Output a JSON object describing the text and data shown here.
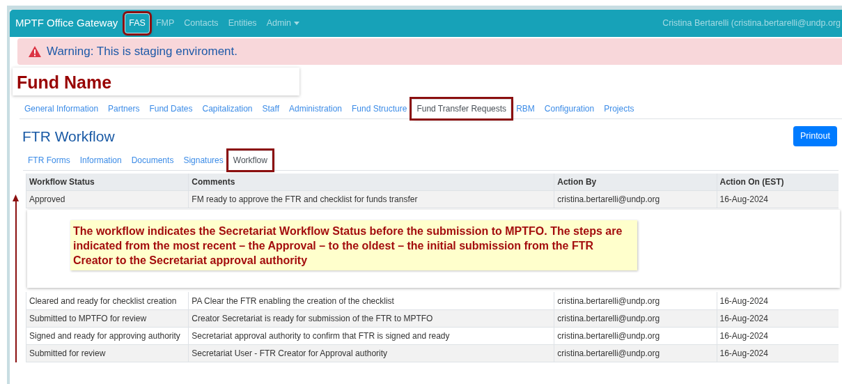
{
  "navbar": {
    "brand": "MPTF Office Gateway",
    "items": [
      {
        "label": "FAS",
        "selected": true,
        "highlighted": true,
        "dropdown": false
      },
      {
        "label": "FMP",
        "selected": false,
        "highlighted": false,
        "dropdown": false
      },
      {
        "label": "Contacts",
        "selected": false,
        "highlighted": false,
        "dropdown": false
      },
      {
        "label": "Entities",
        "selected": false,
        "highlighted": false,
        "dropdown": false
      },
      {
        "label": "Admin",
        "selected": false,
        "highlighted": false,
        "dropdown": true
      }
    ],
    "user": "Cristina Bertarelli (cristina.bertarelli@undp.org"
  },
  "alert": {
    "text": "Warning: This is staging enviroment."
  },
  "fund_title": "Fund Name",
  "fund_tabs": [
    {
      "label": "General Information",
      "selected": false,
      "highlighted": false
    },
    {
      "label": "Partners",
      "selected": false,
      "highlighted": false
    },
    {
      "label": "Fund Dates",
      "selected": false,
      "highlighted": false
    },
    {
      "label": "Capitalization",
      "selected": false,
      "highlighted": false
    },
    {
      "label": "Staff",
      "selected": false,
      "highlighted": false
    },
    {
      "label": "Administration",
      "selected": false,
      "highlighted": false
    },
    {
      "label": "Fund Structure",
      "selected": false,
      "highlighted": false
    },
    {
      "label": "Fund Transfer Requests",
      "selected": true,
      "highlighted": true
    },
    {
      "label": "RBM",
      "selected": false,
      "highlighted": false
    },
    {
      "label": "Configuration",
      "selected": false,
      "highlighted": false
    },
    {
      "label": "Projects",
      "selected": false,
      "highlighted": false
    }
  ],
  "page_title": "FTR Workflow",
  "printout_button": "Printout",
  "sub_tabs": [
    {
      "label": "FTR Forms",
      "selected": false,
      "highlighted": false
    },
    {
      "label": "Information",
      "selected": false,
      "highlighted": false
    },
    {
      "label": "Documents",
      "selected": false,
      "highlighted": false
    },
    {
      "label": "Signatures",
      "selected": false,
      "highlighted": false
    },
    {
      "label": "Workflow",
      "selected": true,
      "highlighted": true
    }
  ],
  "table": {
    "columns": [
      "Workflow Status",
      "Comments",
      "Action By",
      "Action On (EST)"
    ],
    "rows_above": [
      [
        "Approved",
        "FM ready to approve the FTR and checklist for funds transfer",
        "cristina.bertarelli@undp.org",
        "16-Aug-2024"
      ]
    ],
    "rows_below": [
      [
        "Cleared and ready for checklist creation",
        "PA Clear the FTR enabling the creation of the checklist",
        "cristina.bertarelli@undp.org",
        "16-Aug-2024"
      ],
      [
        "Submitted to MPTFO for review",
        "Creator Secretariat is ready for submission of the FTR to MPTFO",
        "cristina.bertarelli@undp.org",
        "16-Aug-2024"
      ],
      [
        "Signed and ready for approving authority",
        "Secretariat approval authority to confirm that FTR is signed and ready",
        "cristina.bertarelli@undp.org",
        "16-Aug-2024"
      ],
      [
        "Submitted for review",
        "Secretariat User - FTR Creator for Approval authority",
        "cristina.bertarelli@undp.org",
        "16-Aug-2024"
      ]
    ]
  },
  "callout": {
    "text": "The workflow indicates the Secretariat Workflow Status before the submission to MPTFO. The steps are indicated from the most recent – the Approval – to the oldest – the initial submission from the FTR Creator to the Secretariat approval authority"
  }
}
